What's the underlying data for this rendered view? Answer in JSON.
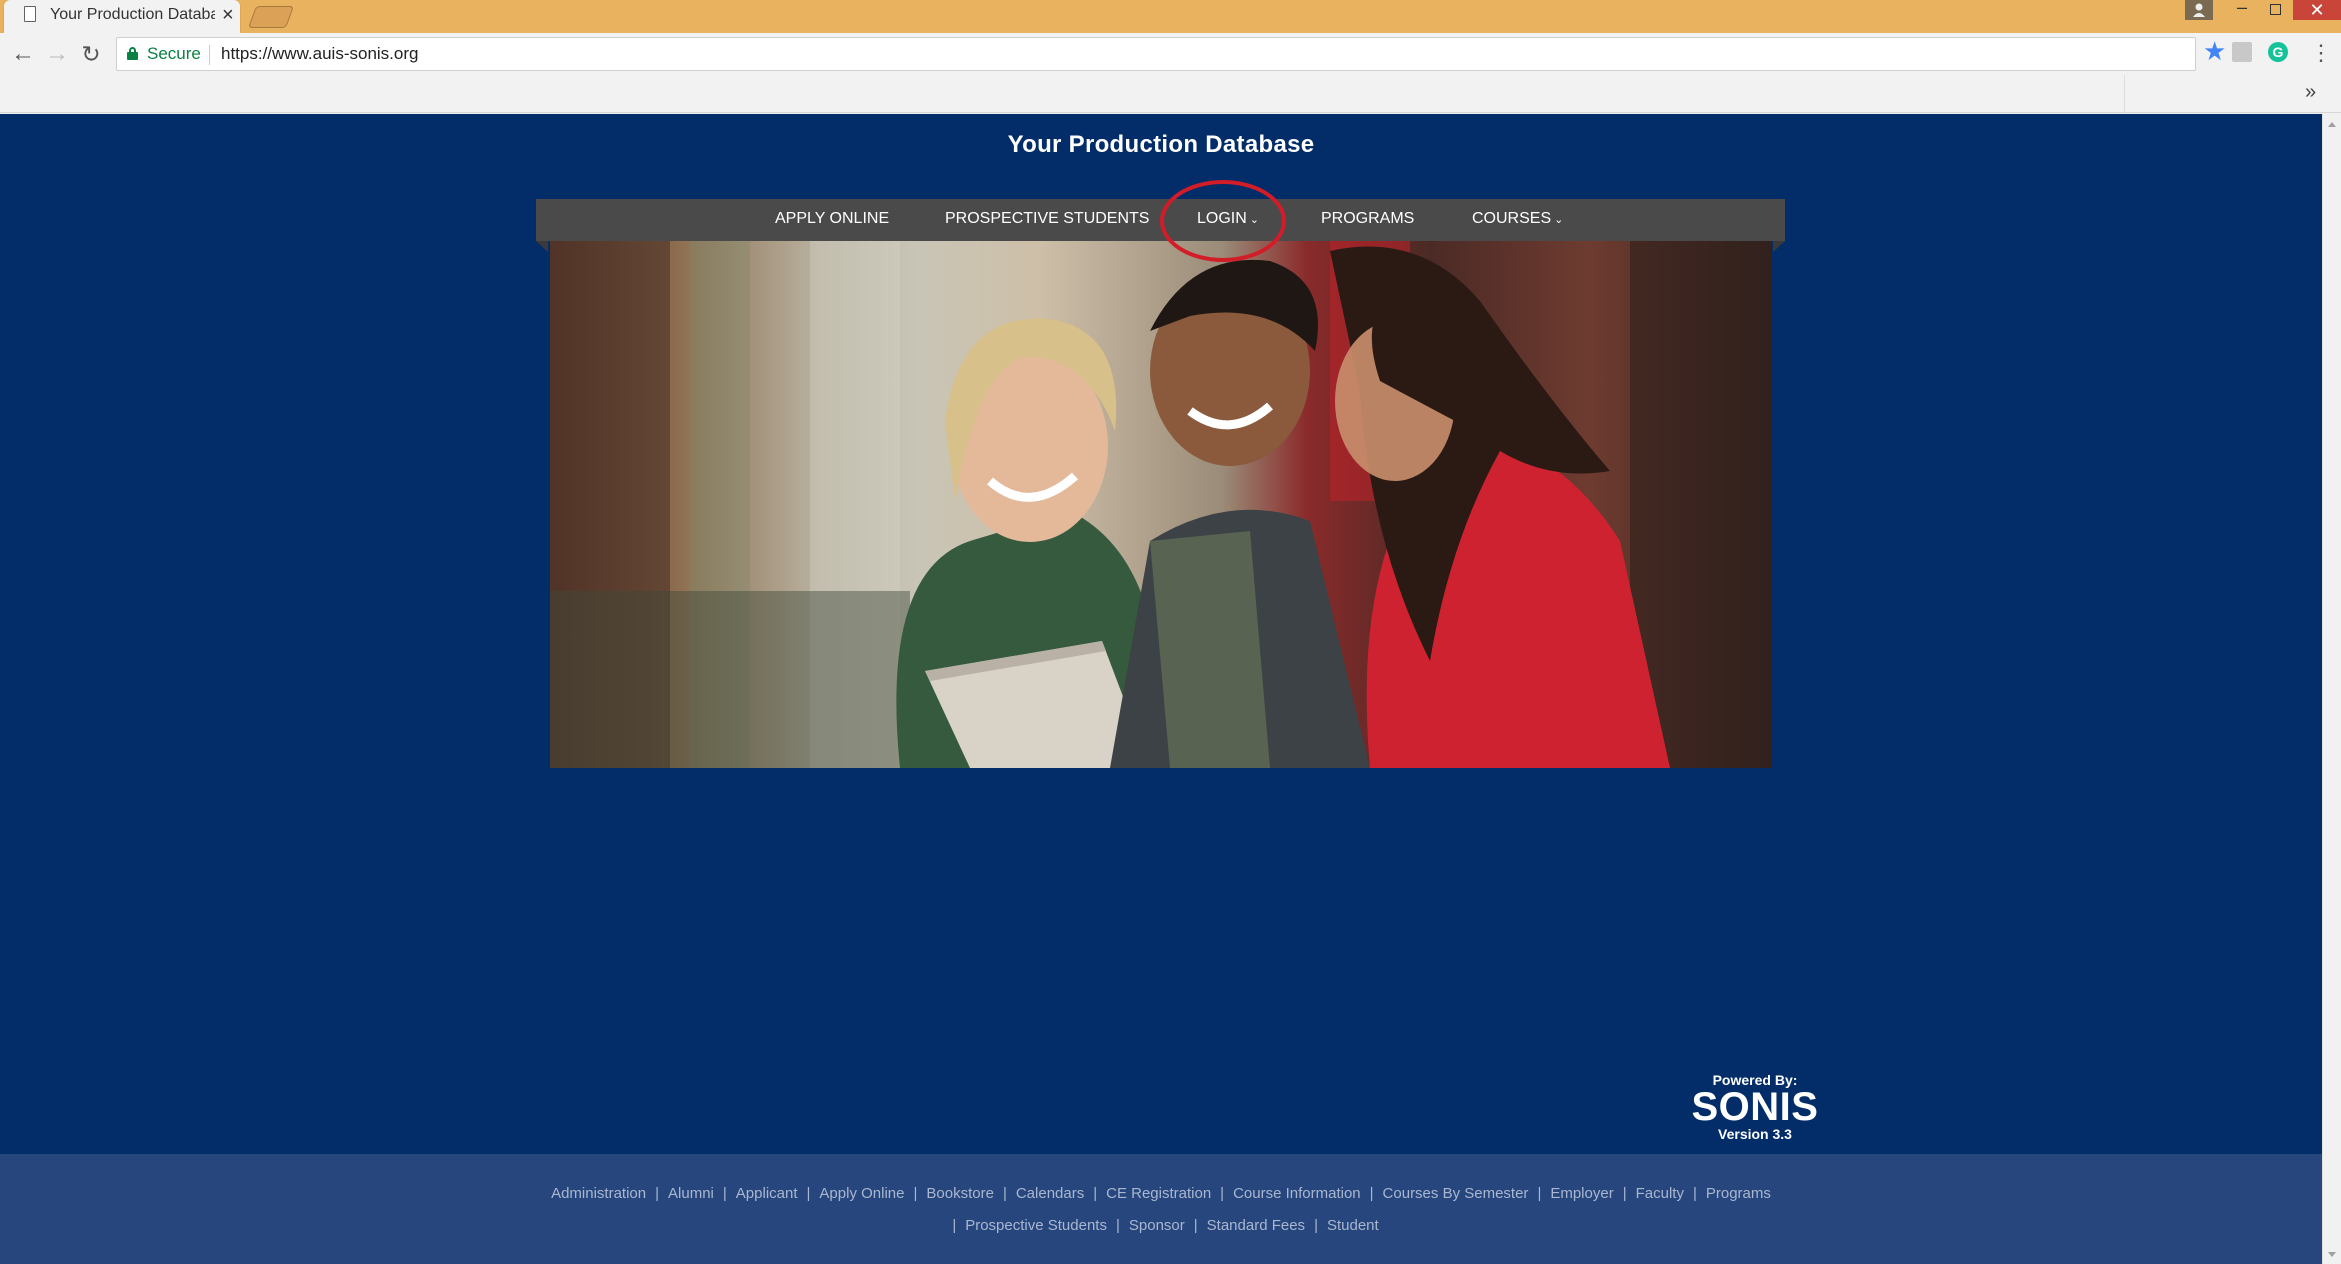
{
  "browser": {
    "tab_title": "Your Production Databa:",
    "secure_label": "Secure",
    "url": "https://www.auis-sonis.org"
  },
  "site": {
    "title": "Your Production Database"
  },
  "nav": {
    "items": [
      {
        "label": "APPLY ONLINE"
      },
      {
        "label": "PROSPECTIVE STUDENTS"
      },
      {
        "label": "LOGIN",
        "dropdown": true
      },
      {
        "label": "PROGRAMS"
      },
      {
        "label": "COURSES",
        "dropdown": true
      }
    ]
  },
  "hero": {
    "icon": "photo-students-laughing"
  },
  "powered_by": {
    "label": "Powered By:",
    "brand": "SONIS",
    "version": "Version 3.3"
  },
  "footer": {
    "row1": [
      "Administration",
      "Alumni",
      "Applicant",
      "Apply Online",
      "Bookstore",
      "Calendars",
      "CE Registration",
      "Course Information",
      "Courses By Semester",
      "Employer",
      "Faculty",
      "Programs"
    ],
    "row2": [
      "Prospective Students",
      "Sponsor",
      "Standard Fees",
      "Student"
    ]
  },
  "colors": {
    "page_bg": "#022d69",
    "nav_bg": "#4a4a4a",
    "footer_bg": "#26467d",
    "highlight_circle": "#d21c28"
  }
}
